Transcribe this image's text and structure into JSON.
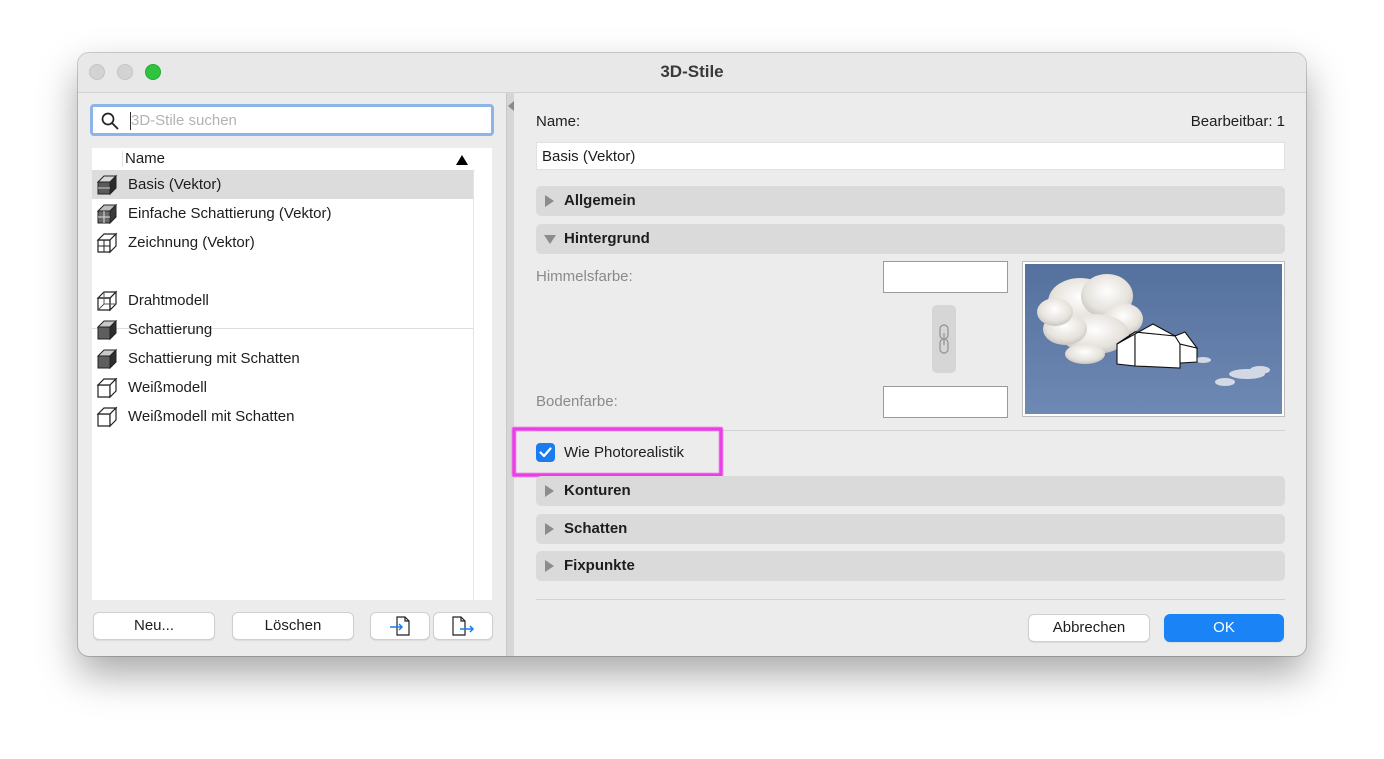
{
  "window": {
    "title": "3D-Stile"
  },
  "search": {
    "placeholder": "3D-Stile suchen"
  },
  "list": {
    "column_name": "Name",
    "items": [
      {
        "label": "Basis (Vektor)",
        "icon": "vector-cube-icon",
        "selected": true
      },
      {
        "label": "Einfache Schattierung (Vektor)",
        "icon": "vector-cube-icon"
      },
      {
        "label": "Zeichnung (Vektor)",
        "icon": "vector-cube-icon"
      },
      {
        "label": "Drahtmodell",
        "icon": "wireframe-cube-icon"
      },
      {
        "label": "Schattierung",
        "icon": "shaded-cube-icon"
      },
      {
        "label": "Schattierung mit Schatten",
        "icon": "shaded-cube-icon"
      },
      {
        "label": "Weißmodell",
        "icon": "white-cube-icon"
      },
      {
        "label": "Weißmodell mit Schatten",
        "icon": "white-cube-icon"
      }
    ]
  },
  "buttons": {
    "new": "Neu...",
    "delete": "Löschen",
    "import_icon": "import-icon",
    "export_icon": "export-icon",
    "cancel": "Abbrechen",
    "ok": "OK"
  },
  "details": {
    "name_label": "Name:",
    "editable": "Bearbeitbar: 1",
    "name_value": "Basis (Vektor)",
    "sections": {
      "general": "Allgemein",
      "background": "Hintergrund",
      "contours": "Konturen",
      "shadows": "Schatten",
      "fixpoints": "Fixpunkte"
    },
    "sky_color_label": "Himmelsfarbe:",
    "ground_color_label": "Bodenfarbe:",
    "photorealistic_label": "Wie Photorealistik",
    "photorealistic_checked": true
  },
  "colors": {
    "accent": "#1a84f6",
    "highlight": "#ea3ee6",
    "sky": "#5d7aa6"
  }
}
